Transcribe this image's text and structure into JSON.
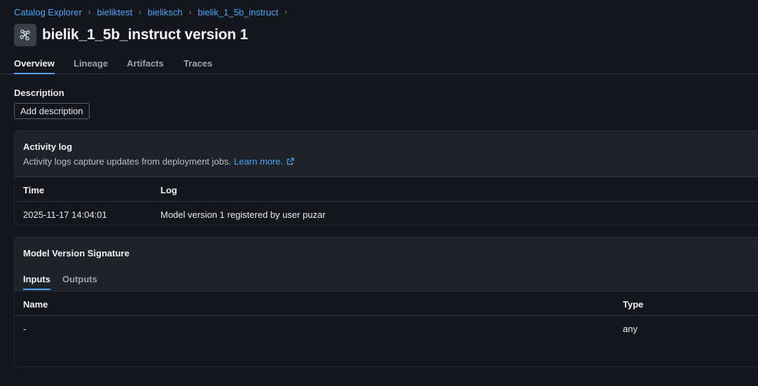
{
  "breadcrumb": [
    "Catalog Explorer",
    "bieliktest",
    "bieliksch",
    "bielik_1_5b_instruct"
  ],
  "page": {
    "title": "bielik_1_5b_instruct version 1"
  },
  "tabs": [
    "Overview",
    "Lineage",
    "Artifacts",
    "Traces"
  ],
  "description": {
    "label": "Description",
    "button": "Add description"
  },
  "activity": {
    "title": "Activity log",
    "subtitle": "Activity logs capture updates from deployment jobs.",
    "link": "Learn more.",
    "columns": [
      "Time",
      "Log"
    ],
    "rows": [
      {
        "time": "2025-11-17 14:04:01",
        "log": "Model version 1 registered by user puzar"
      }
    ]
  },
  "signature": {
    "title": "Model Version Signature",
    "tabs": [
      "Inputs",
      "Outputs"
    ],
    "columns": [
      "Name",
      "Type"
    ],
    "rows": [
      {
        "name": "-",
        "type": "any"
      }
    ]
  },
  "colors": {
    "accent": "#4fa3f7",
    "background": "#13171d",
    "card_header": "#1e232a"
  }
}
